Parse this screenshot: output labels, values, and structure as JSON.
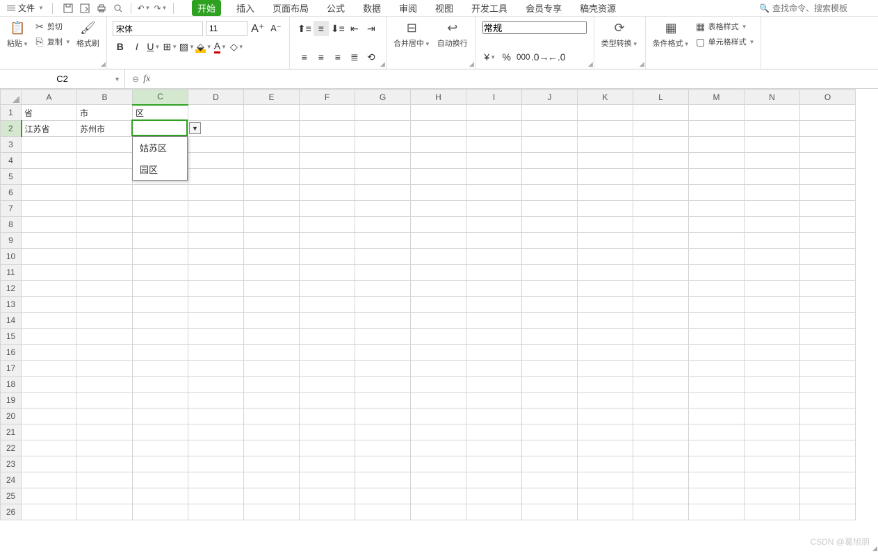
{
  "topbar": {
    "file_label": "文件"
  },
  "tabs": [
    "开始",
    "插入",
    "页面布局",
    "公式",
    "数据",
    "审阅",
    "视图",
    "开发工具",
    "会员专享",
    "稿壳资源"
  ],
  "active_tab": 0,
  "search_placeholder": "查找命令、搜索模板",
  "ribbon": {
    "paste": "粘贴",
    "cut": "剪切",
    "copy": "复制",
    "format_painter": "格式刷",
    "font_name": "宋体",
    "font_size": "11",
    "merge": "合并居中",
    "wrap": "自动换行",
    "number_format": "常规",
    "type_convert": "类型转换",
    "cond_format": "条件格式",
    "table_style": "表格样式",
    "cell_style": "单元格样式"
  },
  "namebox": "C2",
  "formula": "",
  "columns": [
    "A",
    "B",
    "C",
    "D",
    "E",
    "F",
    "G",
    "H",
    "I",
    "J",
    "K",
    "L",
    "M",
    "N",
    "O"
  ],
  "rows": 26,
  "selected_col": 2,
  "selected_row": 1,
  "cells": {
    "r0": {
      "c0": "省",
      "c1": "市",
      "c2": "区"
    },
    "r1": {
      "c0": "江苏省",
      "c1": "苏州市",
      "c2": ""
    }
  },
  "dropdown_options": [
    "姑苏区",
    "园区"
  ],
  "watermark": "CSDN @葛旭朋"
}
